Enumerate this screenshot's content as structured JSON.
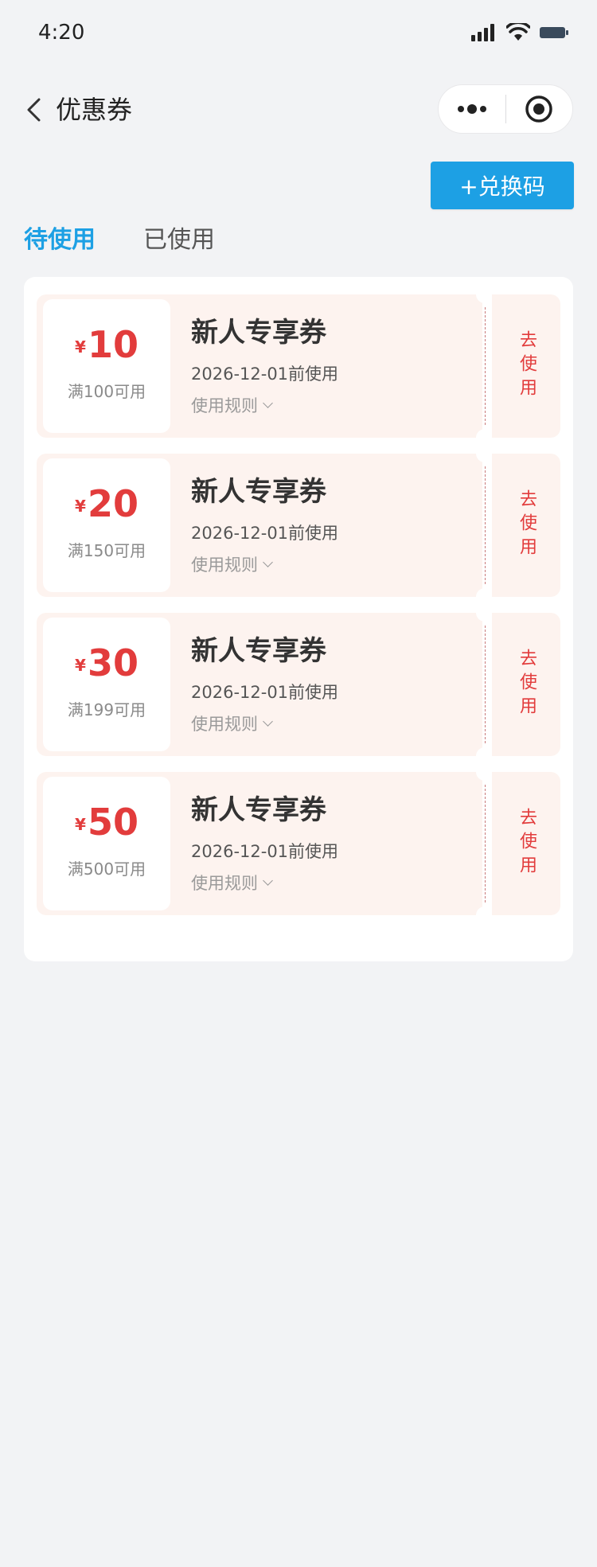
{
  "status_bar": {
    "time": "4:20",
    "icons": [
      "signal-icon",
      "wifi-icon",
      "battery-icon"
    ]
  },
  "nav": {
    "back_icon": "chevron-left-icon",
    "title": "优惠券",
    "capsule_icons": [
      "more-dots-icon",
      "target-icon"
    ]
  },
  "actions": {
    "redeem_label": "+兑换码"
  },
  "tabs": [
    {
      "label": "待使用",
      "active": true
    },
    {
      "label": "已使用",
      "active": false
    }
  ],
  "coupons": [
    {
      "currency": "¥",
      "amount": "10",
      "condition": "满100可用",
      "name": "新人专享券",
      "expiry": "2026-12-01前使用",
      "rules_label": "使用规则",
      "use_label": "去使用"
    },
    {
      "currency": "¥",
      "amount": "20",
      "condition": "满150可用",
      "name": "新人专享券",
      "expiry": "2026-12-01前使用",
      "rules_label": "使用规则",
      "use_label": "去使用"
    },
    {
      "currency": "¥",
      "amount": "30",
      "condition": "满199可用",
      "name": "新人专享券",
      "expiry": "2026-12-01前使用",
      "rules_label": "使用规则",
      "use_label": "去使用"
    },
    {
      "currency": "¥",
      "amount": "50",
      "condition": "满500可用",
      "name": "新人专享券",
      "expiry": "2026-12-01前使用",
      "rules_label": "使用规则",
      "use_label": "去使用"
    }
  ],
  "colors": {
    "accent": "#1da0e4",
    "coupon_red": "#e23c3c",
    "coupon_bg": "#fdf3ef",
    "page_bg": "#f2f3f5"
  }
}
